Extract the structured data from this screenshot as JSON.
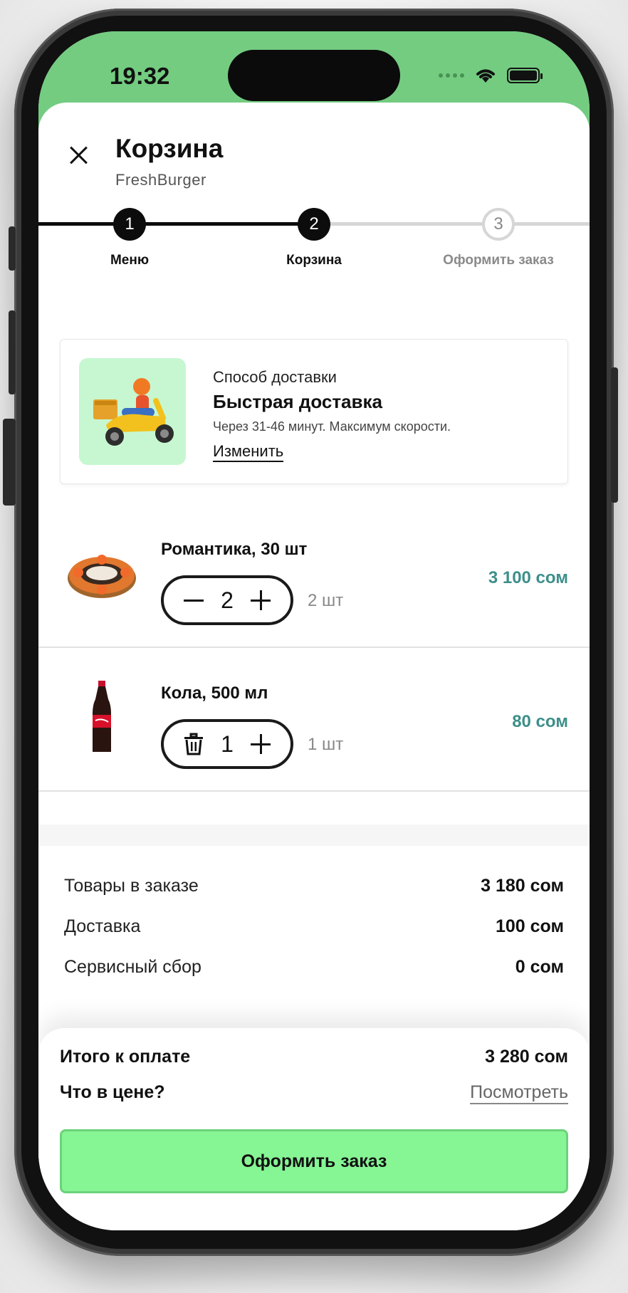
{
  "status_bar": {
    "time": "19:32"
  },
  "header": {
    "title": "Корзина",
    "subtitle": "FreshBurger"
  },
  "stepper": {
    "steps": [
      {
        "number": "1",
        "label": "Меню",
        "state": "done"
      },
      {
        "number": "2",
        "label": "Корзина",
        "state": "current"
      },
      {
        "number": "3",
        "label": "Оформить заказ",
        "state": "todo"
      }
    ]
  },
  "delivery": {
    "label": "Способ доставки",
    "name": "Быстрая доставка",
    "description": "Через 31-46 минут. Максимум скорости.",
    "change_label": "Изменить"
  },
  "cart_items": [
    {
      "name": "Романтика, 30 шт",
      "quantity": "2",
      "unit": "2 шт",
      "price": "3 100 сом",
      "left_control": "minus-icon"
    },
    {
      "name": "Кола, 500 мл",
      "quantity": "1",
      "unit": "1 шт",
      "price": "80 сом",
      "left_control": "trash-icon"
    }
  ],
  "summary": [
    {
      "label": "Товары в заказе",
      "value": "3 180 сом"
    },
    {
      "label": "Доставка",
      "value": "100 сом"
    },
    {
      "label": "Сервисный сбор",
      "value": "0 сом"
    }
  ],
  "checkout": {
    "total_label": "Итого к оплате",
    "total_value": "3 280 сом",
    "whats_in_price": "Что в цене?",
    "view_label": "Посмотреть",
    "button_label": "Оформить заказ"
  },
  "colors": {
    "header_green": "#74cc81",
    "price_teal": "#3d8f8a",
    "cta_green": "#86f594",
    "delivery_thumb_bg": "#c6f7d1"
  }
}
